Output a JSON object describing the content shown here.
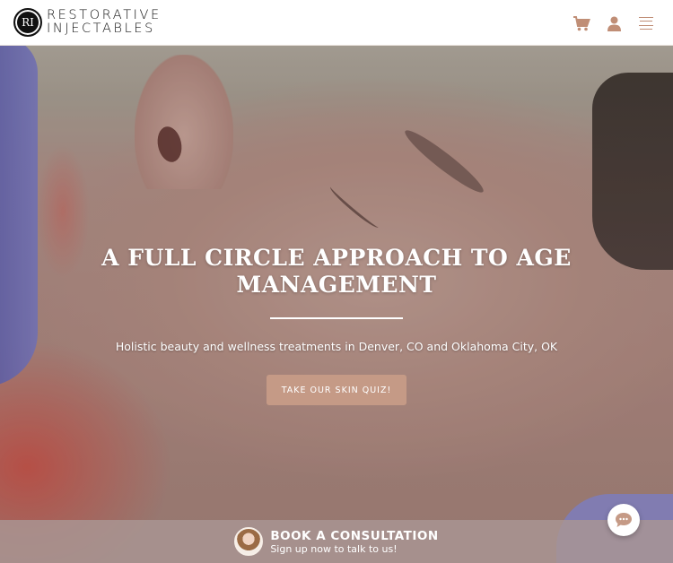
{
  "brand": {
    "mark": "RI",
    "line1": "RESTORATIVE",
    "line2": "INJECTABLES"
  },
  "header": {
    "icons": [
      "cart-icon",
      "user-icon",
      "hamburger-menu-icon"
    ],
    "accent_color": "#c08e76"
  },
  "hero": {
    "title": "A FULL CIRCLE APPROACH TO AGE MANAGEMENT",
    "subtitle": "Holistic beauty and wellness treatments in Denver, CO and Oklahoma City, OK",
    "cta_label": "TAKE OUR SKIN QUIZ!",
    "cta_color": "#c59a86"
  },
  "consultation": {
    "title": "BOOK A CONSULTATION",
    "subtitle": "Sign up now to talk to us!"
  },
  "chat": {
    "icon": "chat-bubble-icon"
  }
}
